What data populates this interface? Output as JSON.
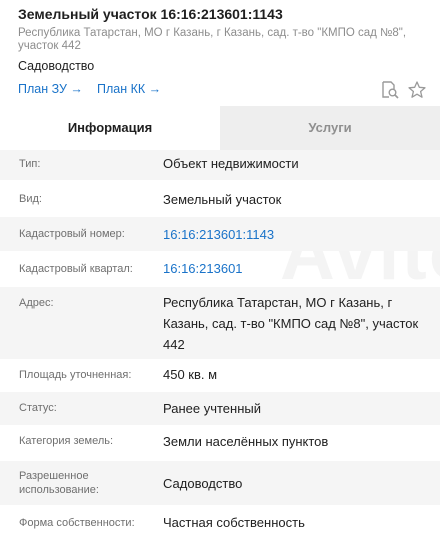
{
  "header": {
    "title": "Земельный участок 16:16:213601:1143",
    "address": "Республика Татарстан, МО г Казань, г Казань, сад. т-во \"КМПО сад №8\", участок 442",
    "purpose": "Садоводство",
    "links": [
      {
        "label": "План ЗУ →"
      },
      {
        "label": "План КК →"
      }
    ],
    "icons": [
      "document-search-icon",
      "star-icon"
    ]
  },
  "tabs": [
    {
      "label": "Информация",
      "active": true
    },
    {
      "label": "Услуги",
      "active": false
    }
  ],
  "details": [
    {
      "label": "Тип:",
      "value": "Объект недвижимости"
    },
    {
      "label": "Вид:",
      "value": "Земельный участок"
    },
    {
      "label": "Кадастровый номер:",
      "value": "16:16:213601:1143",
      "link": true
    },
    {
      "label": "Кадастровый квартал:",
      "value": "16:16:213601",
      "link": true
    },
    {
      "label": "Адрес:",
      "value": "Республика Татарстан, МО г Казань, г Казань, сад. т-во \"КМПО сад №8\", участок 442"
    },
    {
      "label": "Площадь уточненная:",
      "value": "450 кв. м"
    },
    {
      "label": "Статус:",
      "value": "Ранее учтенный"
    },
    {
      "label": "Категория земель:",
      "value": "Земли населённых пунктов"
    },
    {
      "label": "Разрешенное использование:",
      "value": "Садоводство"
    },
    {
      "label": "Форма собственности:",
      "value": "Частная собственность"
    }
  ],
  "colors": {
    "link": "#1a73c9",
    "row_shade": "#f5f5f5",
    "inactive_tab": "#eeeeee",
    "label": "#6f6f6f"
  }
}
